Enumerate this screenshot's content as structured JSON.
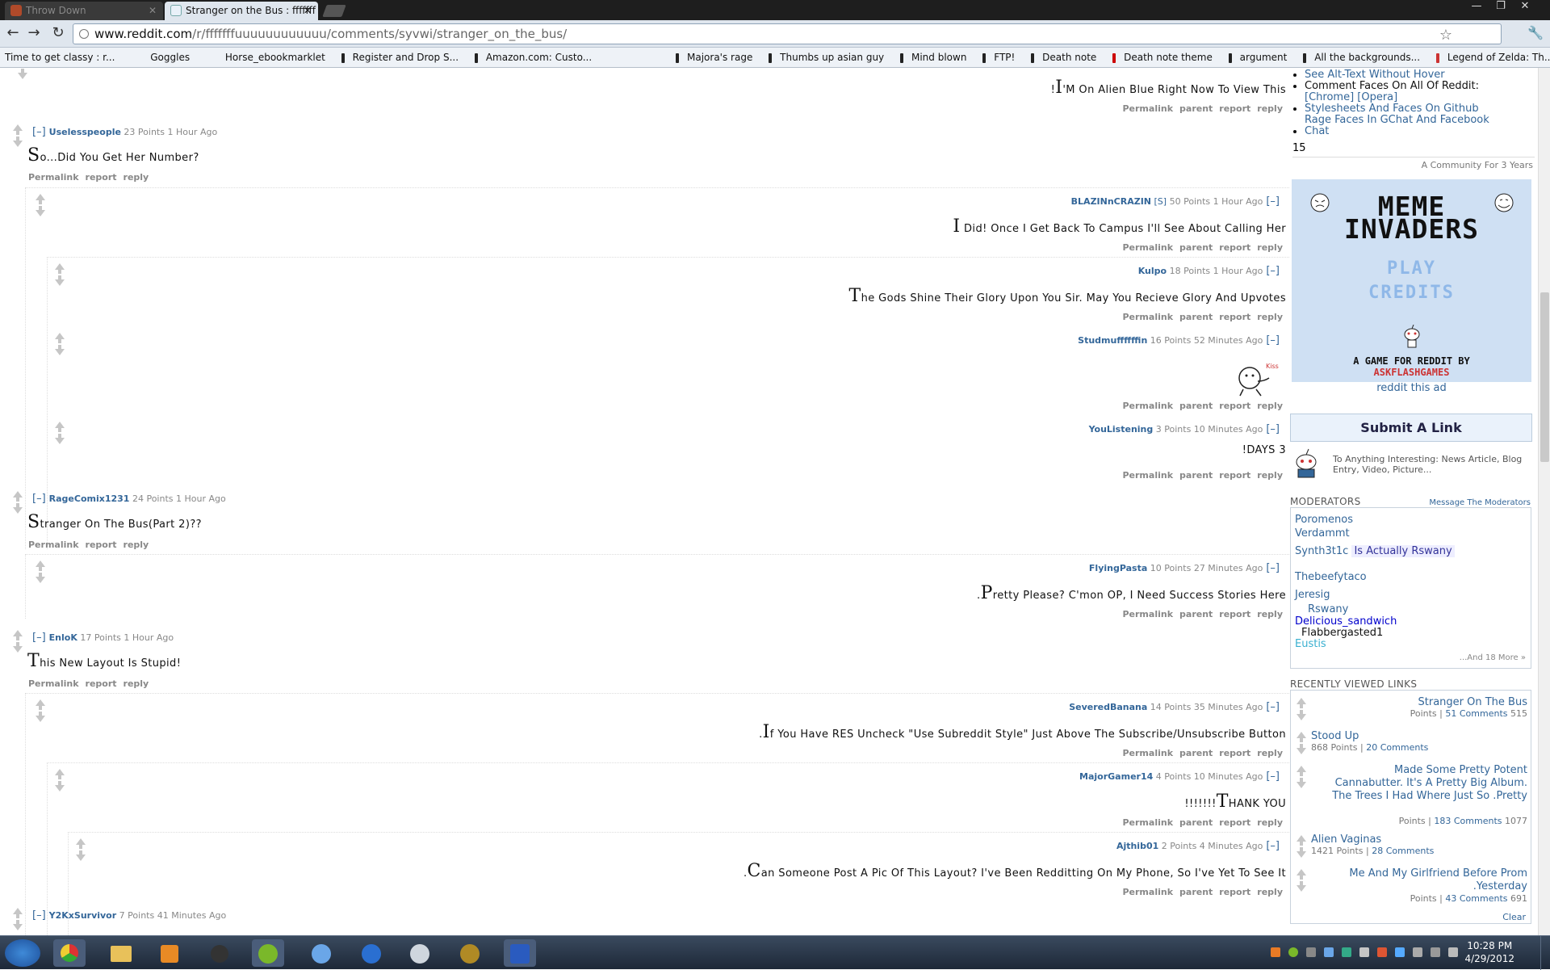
{
  "browser": {
    "tabs": [
      {
        "label": "Throw Down",
        "active": false
      },
      {
        "label": "Stranger on the Bus : fffffff",
        "active": true
      }
    ],
    "url": {
      "host": "www.reddit.com",
      "path": "/r/fffffffuuuuuuuuuuuu/comments/syvwi/stranger_on_the_bus/"
    },
    "bookmarks": [
      "Time to get classy : r...",
      "Goggles",
      "Horse_ebookmarklet",
      "Register and Drop S...",
      "Amazon.com: Custo...",
      "Majora's rage",
      "Thumbs up asian guy",
      "Mind blown",
      "FTP!",
      "Death note",
      "Death note theme",
      "argument",
      "All the backgrounds...",
      "Legend of Zelda: Th..."
    ]
  },
  "buttons": {
    "permalink": "Permalink",
    "parent": "parent",
    "report": "report",
    "reply": "reply",
    "collapse": "[–]"
  },
  "comments": [
    {
      "author": "",
      "meta": "",
      "body_cap": "I",
      "body": "'M On Alien Blue Right Now To View This",
      "prefix": "!"
    },
    {
      "author": "Uselesspeople",
      "meta": "23 Points 1 Hour Ago",
      "body_cap": "S",
      "body": "o...Did You Get Her Number?"
    },
    {
      "author": "BLAZINnCRAZIN",
      "sub": "[S]",
      "meta": "50 Points 1 Hour Ago",
      "body_cap": "I",
      "body": " Did! Once I Get Back To Campus I'll See About Calling Her"
    },
    {
      "author": "Kulpo",
      "meta": "18 Points 1 Hour Ago",
      "body_cap": "T",
      "body": "he Gods Shine Their Glory Upon You Sir. May You Recieve Glory And Upvotes"
    },
    {
      "author": "Studmuffffffin",
      "meta": "16 Points 52 Minutes Ago",
      "image": "kiss-rage-face"
    },
    {
      "author": "YouListening",
      "meta": "3 Points 10 Minutes Ago",
      "body": "!DAYS 3"
    },
    {
      "author": "RageComix1231",
      "meta": "24 Points 1 Hour Ago",
      "body_cap": "S",
      "body": "tranger On The Bus(Part 2)??"
    },
    {
      "author": "FlyingPasta",
      "meta": "10 Points 27 Minutes Ago",
      "prefix": ".",
      "body_cap": "P",
      "body": "retty Please? C'mon OP, I Need Success Stories Here"
    },
    {
      "author": "EnloK",
      "meta": "17 Points 1 Hour Ago",
      "body_cap": "T",
      "body": "his New Layout Is Stupid!"
    },
    {
      "author": "SeveredBanana",
      "meta": "14 Points 35 Minutes Ago",
      "prefix": ".",
      "body_cap": "I",
      "body": "f You Have RES Uncheck \"Use Subreddit Style\" Just Above The Subscribe/Unsubscribe Button"
    },
    {
      "author": "MajorGamer14",
      "meta": "4 Points 10 Minutes Ago",
      "prefix": "!!!!!!!",
      "body_cap": "T",
      "body": "HANK YOU"
    },
    {
      "author": "Ajthib01",
      "meta": "2 Points 4 Minutes Ago",
      "prefix": ".",
      "body_cap": "C",
      "body": "an Someone Post A Pic Of This Layout? I've Been Redditting On My Phone, So I've Yet To See It"
    },
    {
      "author": "Y2KxSurvivor",
      "meta": "7 Points 41 Minutes Ago"
    }
  ],
  "sidebar": {
    "links": [
      "See Alt-Text Without Hover",
      "Stylesheets And Faces On Github",
      "Rage Faces In GChat And Facebook",
      "Chat"
    ],
    "comment_faces": "Comment Faces On All Of Reddit:",
    "browsers": "[Chrome] [Opera]",
    "count": "15",
    "community": "A Community For 3 Years",
    "ad": {
      "title1": "MEME",
      "title2": "INVADERS",
      "play": "PLAY",
      "credits": "CREDITS",
      "tagline": "A GAME FOR REDDIT BY",
      "brand": "ASKFLASHGAMES",
      "reddit_this_ad": "reddit this ad"
    },
    "submit": "Submit A Link",
    "submit_desc": "To Anything Interesting: News Article, Blog Entry, Video, Picture...",
    "moderators_head": "MODERATORS",
    "message_mods": "Message The Moderators",
    "moderators": [
      "Poromenos",
      "Verdammt",
      "Synth3t1c",
      "Thebeefytaco",
      "Jeresig",
      "Rswany",
      "Delicious_sandwich",
      "Flabbergasted1",
      "Eustis"
    ],
    "mod_flair": "Is Actually Rswany",
    "more": "...And 18 More »",
    "recent_head": "RECENTLY VIEWED LINKS",
    "recent": [
      {
        "title": "Stranger On The Bus",
        "stats_a": "Points |",
        "comments": "51 Comments",
        "stats_b": "515"
      },
      {
        "title": "Stood Up",
        "stats_a": "868 Points |",
        "comments": "20 Comments",
        "stats_b": ""
      },
      {
        "title": "Made Some Pretty Potent Cannabutter. It's A Pretty Big Album. The Trees I Had Where Just So .Pretty",
        "stats_a": "Points |",
        "comments": "183 Comments",
        "stats_b": "1077"
      },
      {
        "title": "Alien Vaginas",
        "stats_a": "1421 Points |",
        "comments": "28 Comments",
        "stats_b": ""
      },
      {
        "title": "Me And My Girlfriend Before Prom .Yesterday",
        "stats_a": "Points |",
        "comments": "43 Comments",
        "stats_b": "691"
      }
    ],
    "clear": "Clear"
  },
  "taskbar": {
    "time": "10:28 PM",
    "date": "4/29/2012"
  },
  "colors": {
    "link": "#336699",
    "ad_bg": "#cfe0f3",
    "brand_red": "#cc3333"
  }
}
